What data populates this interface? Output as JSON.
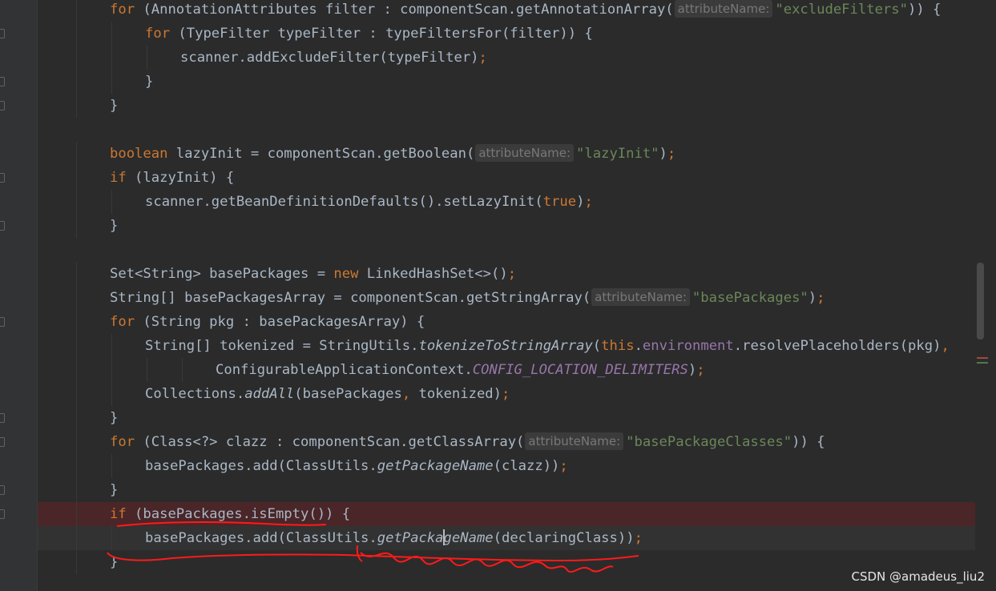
{
  "editor": {
    "lines": [
      {
        "indent": 2,
        "segments": [
          {
            "t": "for",
            "c": "kw"
          },
          {
            "t": " (AnnotationAttributes filter : componentScan.getAnnotationArray("
          },
          {
            "hint": "attributeName:"
          },
          {
            "t": "\"excludeFilters\"",
            "c": "str"
          },
          {
            "t": ")) {"
          }
        ]
      },
      {
        "indent": 3,
        "segments": [
          {
            "t": "for",
            "c": "kw"
          },
          {
            "t": " (TypeFilter typeFilter : typeFiltersFor(filter)) {"
          }
        ]
      },
      {
        "indent": 4,
        "segments": [
          {
            "t": "scanner.addExcludeFilter(typeFilter)"
          },
          {
            "t": ";",
            "c": "semi"
          }
        ]
      },
      {
        "indent": 3,
        "segments": [
          {
            "t": "}"
          }
        ]
      },
      {
        "indent": 2,
        "segments": [
          {
            "t": "}"
          }
        ]
      },
      {
        "indent": 0,
        "segments": []
      },
      {
        "indent": 2,
        "segments": [
          {
            "t": "boolean",
            "c": "kw"
          },
          {
            "t": " lazyInit = componentScan.getBoolean("
          },
          {
            "hint": "attributeName:"
          },
          {
            "t": "\"lazyInit\"",
            "c": "str"
          },
          {
            "t": ")"
          },
          {
            "t": ";",
            "c": "semi"
          }
        ]
      },
      {
        "indent": 2,
        "segments": [
          {
            "t": "if",
            "c": "kw"
          },
          {
            "t": " (lazyInit) {"
          }
        ]
      },
      {
        "indent": 3,
        "segments": [
          {
            "t": "scanner.getBeanDefinitionDefaults().setLazyInit("
          },
          {
            "t": "true",
            "c": "kw"
          },
          {
            "t": ")"
          },
          {
            "t": ";",
            "c": "semi"
          }
        ]
      },
      {
        "indent": 2,
        "segments": [
          {
            "t": "}"
          }
        ]
      },
      {
        "indent": 0,
        "segments": []
      },
      {
        "indent": 2,
        "segments": [
          {
            "t": "Set<String> basePackages = "
          },
          {
            "t": "new",
            "c": "kw"
          },
          {
            "t": " LinkedHashSet<>()"
          },
          {
            "t": ";",
            "c": "semi"
          }
        ]
      },
      {
        "indent": 2,
        "segments": [
          {
            "t": "String[] basePackagesArray = componentScan.getStringArray("
          },
          {
            "hint": "attributeName:"
          },
          {
            "t": "\"basePackages\"",
            "c": "str"
          },
          {
            "t": ")"
          },
          {
            "t": ";",
            "c": "semi"
          }
        ]
      },
      {
        "indent": 2,
        "segments": [
          {
            "t": "for",
            "c": "kw"
          },
          {
            "t": " (String pkg : basePackagesArray) {"
          }
        ]
      },
      {
        "indent": 3,
        "segments": [
          {
            "t": "String[] tokenized = StringUtils."
          },
          {
            "t": "tokenizeToStringArray",
            "c": "it"
          },
          {
            "t": "("
          },
          {
            "t": "this",
            "c": "kw"
          },
          {
            "t": "."
          },
          {
            "t": "environment",
            "c": "fld"
          },
          {
            "t": ".resolvePlaceholders(pkg)"
          },
          {
            "t": ",",
            "c": "semi"
          }
        ]
      },
      {
        "indent": 5,
        "segments": [
          {
            "t": "ConfigurableApplicationContext."
          },
          {
            "t": "CONFIG_LOCATION_DELIMITERS",
            "c": "const"
          },
          {
            "t": ")"
          },
          {
            "t": ";",
            "c": "semi"
          }
        ]
      },
      {
        "indent": 3,
        "segments": [
          {
            "t": "Collections."
          },
          {
            "t": "addAll",
            "c": "it"
          },
          {
            "t": "(basePackages"
          },
          {
            "t": ",",
            "c": "semi"
          },
          {
            "t": " tokenized)"
          },
          {
            "t": ";",
            "c": "semi"
          }
        ]
      },
      {
        "indent": 2,
        "segments": [
          {
            "t": "}"
          }
        ]
      },
      {
        "indent": 2,
        "segments": [
          {
            "t": "for",
            "c": "kw"
          },
          {
            "t": " (Class<?> clazz : componentScan.getClassArray("
          },
          {
            "hint": "attributeName:"
          },
          {
            "t": "\"basePackageClasses\"",
            "c": "str"
          },
          {
            "t": ")) {"
          }
        ]
      },
      {
        "indent": 3,
        "segments": [
          {
            "t": "basePackages.add(ClassUtils."
          },
          {
            "t": "getPackageName",
            "c": "it"
          },
          {
            "t": "(clazz))"
          },
          {
            "t": ";",
            "c": "semi"
          }
        ]
      },
      {
        "indent": 2,
        "segments": [
          {
            "t": "}"
          }
        ]
      },
      {
        "indent": 2,
        "state": "error",
        "segments": [
          {
            "t": "if",
            "c": "kw"
          },
          {
            "t": " (basePackages.isEmpty()) {"
          }
        ]
      },
      {
        "indent": 3,
        "state": "current",
        "segments": [
          {
            "t": "basePackages.add(ClassUtils."
          },
          {
            "t": "getPacka",
            "c": "it"
          },
          {
            "caret": true
          },
          {
            "t": "geName",
            "c": "it"
          },
          {
            "t": "(declaringClass))"
          },
          {
            "t": ";",
            "c": "semi"
          }
        ]
      },
      {
        "indent": 2,
        "segments": [
          {
            "t": "}"
          }
        ]
      }
    ]
  },
  "watermark": "CSDN @amadeus_liu2",
  "colors": {
    "background": "#2b2b2b",
    "keyword": "#cc7832",
    "string": "#6a8759",
    "field": "#9876aa",
    "default_text": "#a9b7c6",
    "error_line": "#4a2628",
    "annotation_red": "#ff1a1a"
  }
}
